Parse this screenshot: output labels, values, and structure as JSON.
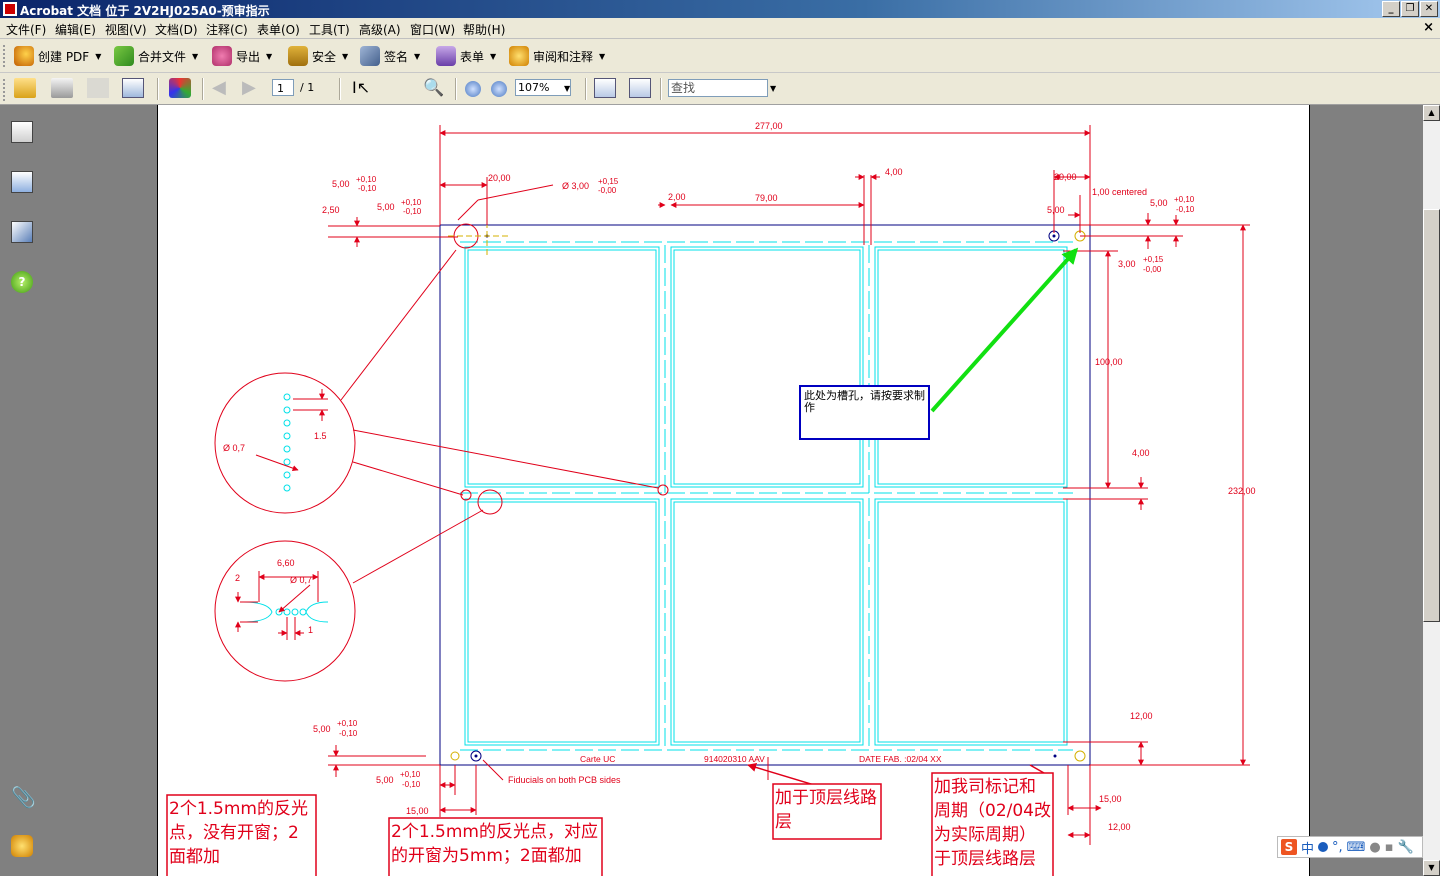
{
  "window": {
    "title": "Acrobat 文档 位于 2V2HJ025A0-预审指示"
  },
  "menubar": {
    "items": [
      "文件(F)",
      "编辑(E)",
      "视图(V)",
      "文档(D)",
      "注释(C)",
      "表单(O)",
      "工具(T)",
      "高级(A)",
      "窗口(W)",
      "帮助(H)"
    ],
    "close_glyph": "×"
  },
  "toolbar1": {
    "create_pdf": "创建 PDF",
    "combine_files": "合并文件",
    "export": "导出",
    "security": "安全",
    "sign": "签名",
    "forms": "表单",
    "review_comment": "审阅和注释"
  },
  "toolbar2": {
    "page_current": "1",
    "page_total": "/ 1",
    "zoom": "107%",
    "find_placeholder": "查找"
  },
  "drawing": {
    "dims": {
      "width": "277,00",
      "d20_left": "20,00",
      "d5_tol_a": "5,00",
      "tol_p010": "+0,10",
      "tol_m010": "-0,10",
      "d250": "2,50",
      "phi3": "Ø 3,00",
      "tol_p015": "+0,15",
      "tol_m000": "-0,00",
      "d200": "2,00",
      "d7900": "79,00",
      "d400": "4,00",
      "d20_right": "20,00",
      "centered": "1,00 centered",
      "d5_right": "5,00",
      "d3_right": "3,00",
      "d100": "100,00",
      "d4_mid": "4,00",
      "height": "232,00",
      "d12": "12,00",
      "d15": "15,00",
      "d12b": "12,00",
      "d15_bottom": "15,00",
      "d5_bl": "5,00",
      "d5_bl2": "5,00",
      "phi07a": "Ø 0,7",
      "d15small": "1.5",
      "d660": "6,60",
      "phi07b": "Ø 0,7",
      "d2": "2",
      "d1": "1"
    },
    "labels": {
      "carte": "Carte UC",
      "partno": "914020310 AAV",
      "datefab": "DATE FAB. :02/04 XX",
      "fiducials": "Fiducials on both PCB sides"
    }
  },
  "annotations": {
    "slot_note": "此处为槽孔，请按要求制作",
    "fiducial_note_1": "2个1.5mm的反光点，没有开窗；2面都加",
    "fiducial_note_2": "2个1.5mm的反光点，对应的开窗为5mm；2面都加",
    "top_layer_note": "加于顶层线路层",
    "date_note": "加我司标记和周期（02/04改为实际周期）于顶层线路层"
  },
  "ime": {
    "mode": "中"
  },
  "colors": {
    "dim_red": "#e0001a",
    "outline_cyan": "#00e0e8",
    "board_navy": "#000080",
    "arrow_green": "#11e011"
  }
}
